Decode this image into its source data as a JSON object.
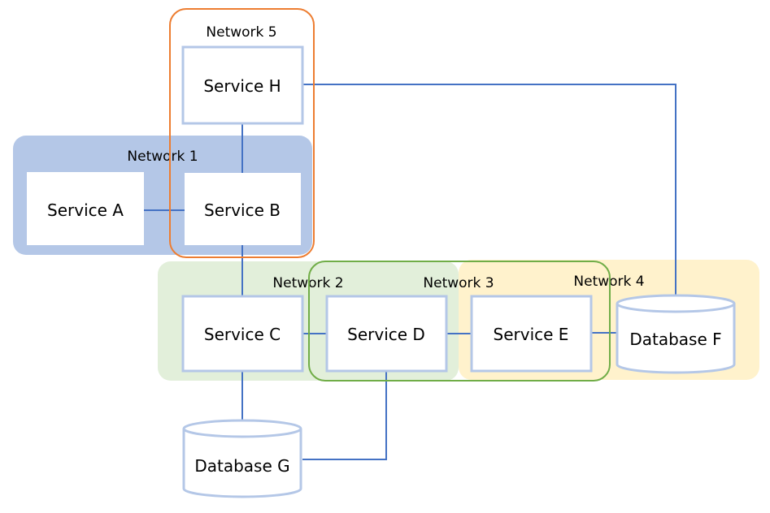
{
  "diagram": {
    "colors": {
      "network1_fill": "#b4c7e7",
      "network2_fill": "#e2efda",
      "network4_fill": "#fff2cc",
      "network3_stroke": "#70ad47",
      "network5_stroke": "#ed7d31",
      "node_stroke": "#b4c7e7",
      "edge": "#4472c4",
      "node_fill": "#ffffff"
    },
    "networks": [
      {
        "id": "network1",
        "label": "Network 1",
        "style": "filled"
      },
      {
        "id": "network2",
        "label": "Network 2",
        "style": "filled"
      },
      {
        "id": "network3",
        "label": "Network 3",
        "style": "outlined"
      },
      {
        "id": "network4",
        "label": "Network 4",
        "style": "filled"
      },
      {
        "id": "network5",
        "label": "Network 5",
        "style": "outlined"
      }
    ],
    "nodes": [
      {
        "id": "service-a",
        "label": "Service A",
        "kind": "service",
        "networks": [
          "network1"
        ]
      },
      {
        "id": "service-b",
        "label": "Service B",
        "kind": "service",
        "networks": [
          "network1",
          "network5"
        ]
      },
      {
        "id": "service-c",
        "label": "Service C",
        "kind": "service",
        "networks": [
          "network2"
        ]
      },
      {
        "id": "service-d",
        "label": "Service D",
        "kind": "service",
        "networks": [
          "network2",
          "network3"
        ]
      },
      {
        "id": "service-e",
        "label": "Service E",
        "kind": "service",
        "networks": [
          "network3",
          "network4"
        ]
      },
      {
        "id": "database-f",
        "label": "Database F",
        "kind": "database",
        "networks": [
          "network4"
        ]
      },
      {
        "id": "database-g",
        "label": "Database G",
        "kind": "database",
        "networks": []
      },
      {
        "id": "service-h",
        "label": "Service H",
        "kind": "service",
        "networks": [
          "network5"
        ]
      }
    ],
    "edges": [
      {
        "from": "service-a",
        "to": "service-b"
      },
      {
        "from": "service-h",
        "to": "service-b"
      },
      {
        "from": "service-b",
        "to": "service-c"
      },
      {
        "from": "service-c",
        "to": "service-d"
      },
      {
        "from": "service-d",
        "to": "service-e"
      },
      {
        "from": "service-e",
        "to": "database-f"
      },
      {
        "from": "service-h",
        "to": "database-f"
      },
      {
        "from": "service-c",
        "to": "database-g"
      },
      {
        "from": "service-d",
        "to": "database-g"
      }
    ]
  }
}
